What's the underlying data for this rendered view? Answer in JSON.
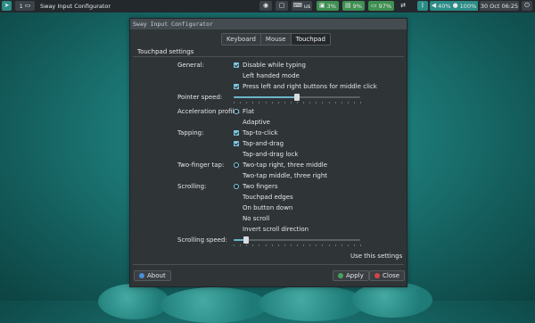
{
  "topbar": {
    "workspace_label": "1",
    "window_title": "Sway Input Configurator",
    "keyboard_layout": "us",
    "brightness": "3%",
    "volume": "9%",
    "battery": "97%",
    "wifi": "40%",
    "mic": "100%",
    "datetime": "30 Oct 06:25",
    "colors": {
      "bar": "#23282d",
      "green": "#3f8f52",
      "teal": "#2c8c86",
      "dark": "#3b4248"
    }
  },
  "window": {
    "title": "Sway Input Configurator",
    "tabs": [
      {
        "label": "Keyboard",
        "active": false
      },
      {
        "label": "Mouse",
        "active": false
      },
      {
        "label": "Touchpad",
        "active": true
      }
    ],
    "section_title": "Touchpad settings",
    "general": {
      "label": "General:",
      "options": [
        {
          "label": "Disable while typing",
          "checked": true
        },
        {
          "label": "Left handed mode",
          "checked": false
        },
        {
          "label": "Press left and right buttons for middle click",
          "checked": true
        }
      ]
    },
    "pointer_speed": {
      "label": "Pointer speed:",
      "value": 0.5
    },
    "acceleration": {
      "label": "Acceleration profile:",
      "options": [
        {
          "label": "Flat",
          "selected": true
        },
        {
          "label": "Adaptive",
          "selected": false
        }
      ]
    },
    "tapping": {
      "label": "Tapping:",
      "options": [
        {
          "label": "Tap-to-click",
          "checked": true
        },
        {
          "label": "Tap-and-drag",
          "checked": true
        },
        {
          "label": "Tap-and-drag lock",
          "checked": false
        }
      ]
    },
    "two_finger_tap": {
      "label": "Two-finger tap:",
      "options": [
        {
          "label": "Two-tap right, three middle",
          "selected": true
        },
        {
          "label": "Two-tap middle, three right",
          "selected": false
        }
      ]
    },
    "scrolling": {
      "label": "Scrolling:",
      "options": [
        {
          "label": "Two fingers",
          "selected": true
        },
        {
          "label": "Touchpad edges",
          "selected": false
        },
        {
          "label": "On button down",
          "selected": false
        },
        {
          "label": "No scroll",
          "selected": false
        }
      ],
      "invert": {
        "label": "Invert scroll direction",
        "checked": false
      }
    },
    "scrolling_speed": {
      "label": "Scrolling speed:",
      "value": 0.1
    },
    "use_settings": {
      "label": "Use this settings",
      "checked": false
    },
    "buttons": {
      "about": "About",
      "apply": "Apply",
      "close": "Close"
    },
    "accent": "#7ec8e3"
  }
}
